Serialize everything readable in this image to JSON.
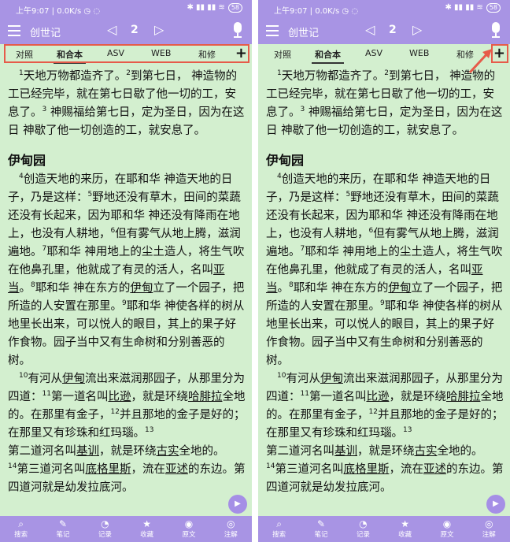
{
  "status": {
    "time": "上午9:07",
    "speed": "0.0K/s",
    "battery": "58"
  },
  "header": {
    "book": "创世记",
    "chapter": "2",
    "prev": "◁",
    "next": "▷"
  },
  "tabs": [
    "对照",
    "和合本",
    "ASV",
    "WEB",
    "和修"
  ],
  "active_tab": "和合本",
  "plus_label": "+",
  "content": {
    "v1_num": "1",
    "v1": "天地万物都造齐了。",
    "v2_num": "2",
    "v2": "到第七日，  神造物的工已经完毕，就在第七日歇了他一切的工，安息了。",
    "v3_num": "3",
    "v3": " 神赐福给第七日，定为圣日，因为在这日  神歇了他一切创造的工，就安息了。",
    "heading": "伊甸园",
    "v4_num": "4",
    "v4": "创造天地的来历，在耶和华  神造天地的日子，乃是这样：",
    "v5_num": "5",
    "v5": "野地还没有草木，田间的菜蔬还没有长起来，因为耶和华  神还没有降雨在地上，也没有人耕地，",
    "v6_num": "6",
    "v6": "但有雾气从地上腾，滋润遍地。",
    "v7_num": "7",
    "v7a": "耶和华  神用地上的尘土造人，将生气吹在他鼻孔里，他就成了有灵的活人，名叫",
    "v7_name": "亚当",
    "v7b": "。",
    "v8_num": "8",
    "v8a": "耶和华  神在东方的",
    "v8_place": "伊甸",
    "v8b": "立了一个园子，把所造的人安置在那里。",
    "v9_num": "9",
    "v9": "耶和华  神使各样的树从地里长出来，可以悦人的眼目，其上的果子好作食物。园子当中又有生命树和分别善恶的树。",
    "v10_num": "10",
    "v10a": "有河从",
    "v10_place": "伊甸",
    "v10b": "流出来滋润那园子，从那里分为四道：",
    "v11_num": "11",
    "v11a": "第一道名叫",
    "v11_river": "比逊",
    "v11b": "，就是环绕",
    "v11_land": "哈腓拉",
    "v11c": "全地的。在那里有金子，",
    "v12_num": "12",
    "v12": "并且那地的金子是好的；在那里又有珍珠和红玛瑙。",
    "v13_num": "13",
    "v13a": "第二道河名叫",
    "v13_river": "基训",
    "v13b": "，就是环绕",
    "v13_land": "古实",
    "v13c": "全地的。",
    "v14_num": "14",
    "v14a": "第三道河名叫",
    "v14_river": "底格里斯",
    "v14b": "，流在",
    "v14_land": "亚述",
    "v14c": "的东边。第四道河就是幼发拉底河。"
  },
  "fab": "▶",
  "bottom_nav": [
    {
      "label": "搜索",
      "icon": "search-icon"
    },
    {
      "label": "笔记",
      "icon": "note-icon"
    },
    {
      "label": "记录",
      "icon": "history-icon"
    },
    {
      "label": "收藏",
      "icon": "star-icon"
    },
    {
      "label": "原文",
      "icon": "original-text-icon"
    },
    {
      "label": "注解",
      "icon": "commentary-icon"
    }
  ],
  "colors": {
    "accent": "#a894e4",
    "background": "#d3efcf",
    "highlight": "#e65b4a"
  }
}
